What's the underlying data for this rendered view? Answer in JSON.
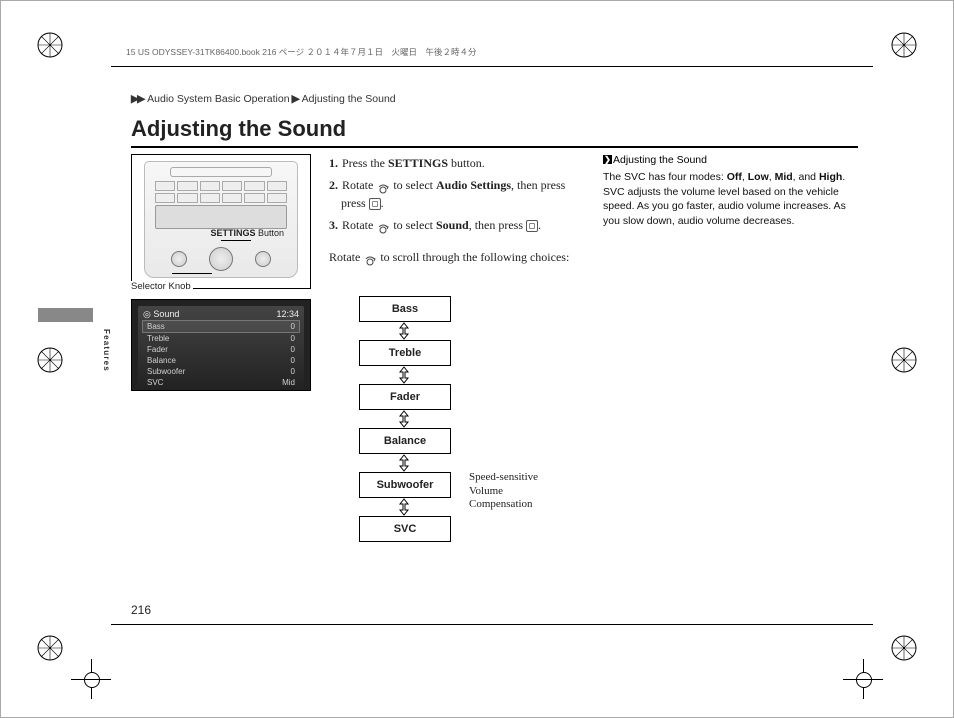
{
  "runhead": "15 US ODYSSEY-31TK86400.book  216 ページ  ２０１４年７月１日　火曜日　午後２時４分",
  "breadcrumb": {
    "arrow": "▶▶",
    "a": "Audio System Basic Operation",
    "b": "Adjusting the Sound"
  },
  "title": "Adjusting the Sound",
  "page_number": "216",
  "side_tab_label": "Features",
  "diagram": {
    "settings_button_prefix": "SETTINGS",
    "settings_button_suffix": " Button",
    "selector_knob": "Selector Knob"
  },
  "screen": {
    "header_left": "◎ Sound",
    "header_right": "12:34",
    "rows": [
      {
        "name": "Bass",
        "val": "0"
      },
      {
        "name": "Treble",
        "val": "0"
      },
      {
        "name": "Fader",
        "val": "0"
      },
      {
        "name": "Balance",
        "val": "0"
      },
      {
        "name": "Subwoofer",
        "val": "0"
      },
      {
        "name": "SVC",
        "val": "Mid"
      }
    ]
  },
  "steps": {
    "s1a": "Press the ",
    "s1b": "SETTINGS",
    "s1c": " button.",
    "s2a": "Rotate ",
    "s2b": " to select ",
    "s2c": "Audio Settings",
    "s2d": ", then press ",
    "s2e": ".",
    "s3a": "Rotate ",
    "s3b": " to select ",
    "s3c": "Sound",
    "s3d": ", then press ",
    "s3e": ".",
    "tail_a": "Rotate ",
    "tail_b": " to scroll through the following choices:"
  },
  "options": [
    "Bass",
    "Treble",
    "Fader",
    "Balance",
    "Subwoofer",
    "SVC"
  ],
  "svc_caption_l1": "Speed-sensitive",
  "svc_caption_l2": "Volume",
  "svc_caption_l3": "Compensation",
  "sidebar": {
    "heading": "Adjusting the Sound",
    "t1": "The SVC has four modes: ",
    "m1": "Off",
    "c": ", ",
    "m2": "Low",
    "m3": "Mid",
    "and": ", and ",
    "m4": "High",
    "p": ". ",
    "t2": "SVC adjusts the volume level based on the vehicle speed. As you go faster, audio volume increases. As you slow down, audio volume decreases."
  }
}
